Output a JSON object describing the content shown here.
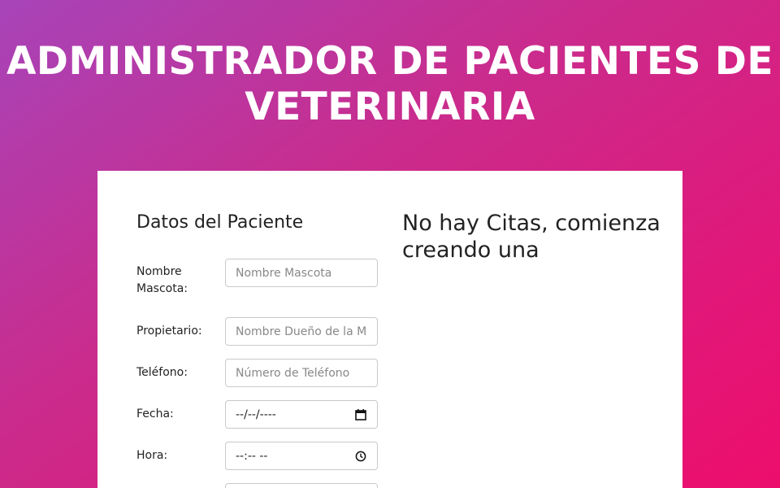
{
  "header": {
    "title": "ADMINISTRADOR DE PACIENTES DE VETERINARIA"
  },
  "form": {
    "heading": "Datos del Paciente",
    "fields": [
      {
        "label": "Nombre Mascota:",
        "placeholder": "Nombre Mascota"
      },
      {
        "label": "Propietario:",
        "placeholder": "Nombre Dueño de la Mascota"
      },
      {
        "label": "Teléfono:",
        "placeholder": "Número de Teléfono"
      },
      {
        "label": "Fecha:",
        "value": "--/--/----",
        "icon": "calendar-icon"
      },
      {
        "label": "Hora:",
        "value": "--:-- --",
        "icon": "clock-icon"
      }
    ]
  },
  "appointments": {
    "empty_message": "No hay Citas, comienza creando una"
  },
  "colors": {
    "gradient_start": "#a744b9",
    "gradient_end": "#ed0e6c",
    "card_bg": "#ffffff"
  }
}
